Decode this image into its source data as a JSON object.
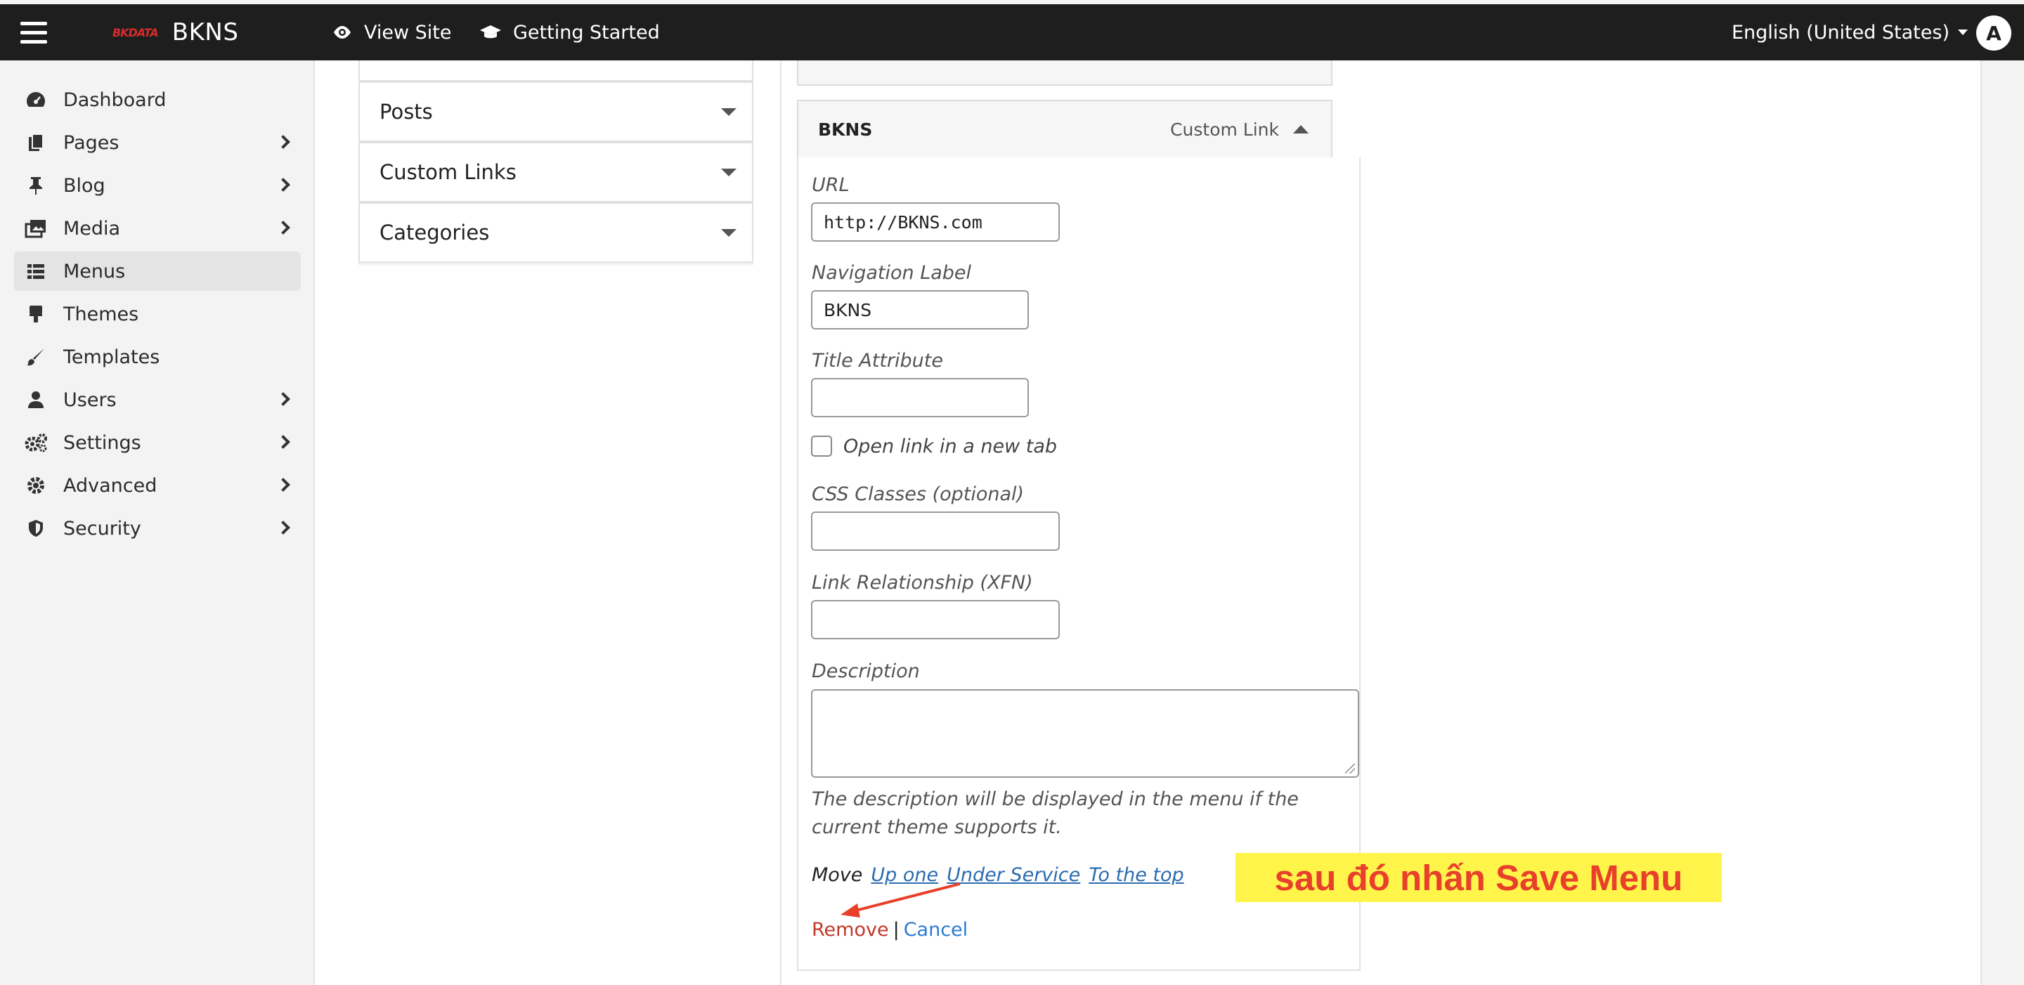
{
  "topbar": {
    "logo_mark": "BKDATA",
    "brand": "BKNS",
    "view_site": "View Site",
    "getting_started": "Getting Started",
    "language": "English (United States)",
    "avatar_initial": "A"
  },
  "sidebar": {
    "items": [
      {
        "label": "Dashboard",
        "icon": "dashboard-icon",
        "has_submenu": false
      },
      {
        "label": "Pages",
        "icon": "pages-icon",
        "has_submenu": true
      },
      {
        "label": "Blog",
        "icon": "pin-icon",
        "has_submenu": true
      },
      {
        "label": "Media",
        "icon": "media-icon",
        "has_submenu": true
      },
      {
        "label": "Menus",
        "icon": "list-icon",
        "has_submenu": false,
        "active": true
      },
      {
        "label": "Themes",
        "icon": "brush-roller-icon",
        "has_submenu": false
      },
      {
        "label": "Templates",
        "icon": "brush-icon",
        "has_submenu": false
      },
      {
        "label": "Users",
        "icon": "user-icon",
        "has_submenu": true
      },
      {
        "label": "Settings",
        "icon": "gears-icon",
        "has_submenu": true
      },
      {
        "label": "Advanced",
        "icon": "gear-icon",
        "has_submenu": true
      },
      {
        "label": "Security",
        "icon": "shield-icon",
        "has_submenu": true
      }
    ]
  },
  "left_panel": {
    "sections": [
      "Posts",
      "Custom Links",
      "Categories"
    ]
  },
  "menu_item": {
    "title": "BKNS",
    "type": "Custom Link",
    "url_label": "URL",
    "url_value": "http://BKNS.com",
    "nav_label_label": "Navigation Label",
    "nav_label_value": "BKNS",
    "title_attr_label": "Title Attribute",
    "title_attr_value": "",
    "new_tab_label": "Open link in a new tab",
    "css_label": "CSS Classes (optional)",
    "css_value": "",
    "xfn_label": "Link Relationship (XFN)",
    "xfn_value": "",
    "description_label": "Description",
    "description_value": "",
    "description_help": "The description will be displayed in the menu if the current theme supports it.",
    "move_label": "Move",
    "move_links": [
      "Up one",
      "Under Service",
      "To the top"
    ],
    "remove": "Remove",
    "separator": "|",
    "cancel": "Cancel"
  },
  "annotation": {
    "text": "sau đó nhấn Save Menu",
    "highlight_color": "#fff54a",
    "text_color": "#e8402a"
  },
  "colors": {
    "topbar": "#1e1e1e",
    "sidebar": "#f3f3f3",
    "link": "#2b6cb0",
    "remove": "#c0392b"
  }
}
